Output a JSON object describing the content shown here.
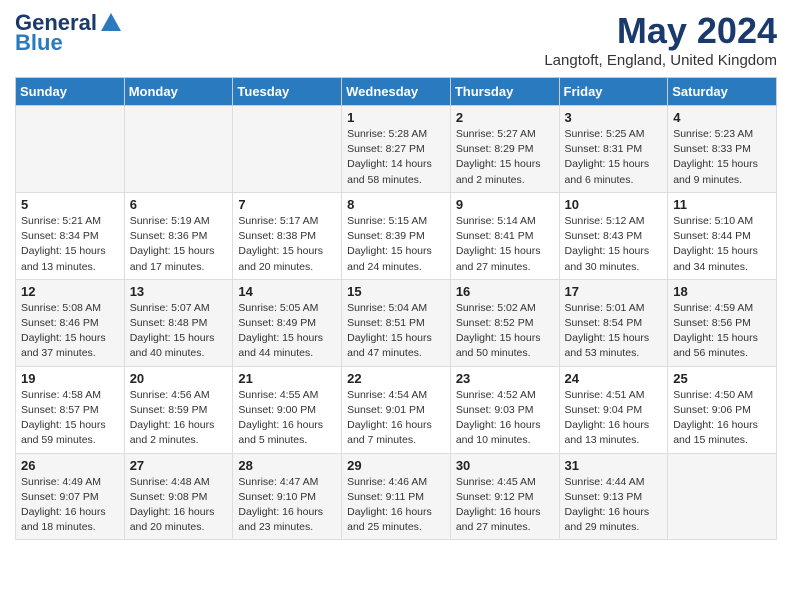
{
  "header": {
    "logo_general": "General",
    "logo_blue": "Blue",
    "month_title": "May 2024",
    "location": "Langtoft, England, United Kingdom"
  },
  "days_of_week": [
    "Sunday",
    "Monday",
    "Tuesday",
    "Wednesday",
    "Thursday",
    "Friday",
    "Saturday"
  ],
  "weeks": [
    [
      {
        "day": "",
        "sunrise": "",
        "sunset": "",
        "daylight": ""
      },
      {
        "day": "",
        "sunrise": "",
        "sunset": "",
        "daylight": ""
      },
      {
        "day": "",
        "sunrise": "",
        "sunset": "",
        "daylight": ""
      },
      {
        "day": "1",
        "sunrise": "Sunrise: 5:28 AM",
        "sunset": "Sunset: 8:27 PM",
        "daylight": "Daylight: 14 hours and 58 minutes."
      },
      {
        "day": "2",
        "sunrise": "Sunrise: 5:27 AM",
        "sunset": "Sunset: 8:29 PM",
        "daylight": "Daylight: 15 hours and 2 minutes."
      },
      {
        "day": "3",
        "sunrise": "Sunrise: 5:25 AM",
        "sunset": "Sunset: 8:31 PM",
        "daylight": "Daylight: 15 hours and 6 minutes."
      },
      {
        "day": "4",
        "sunrise": "Sunrise: 5:23 AM",
        "sunset": "Sunset: 8:33 PM",
        "daylight": "Daylight: 15 hours and 9 minutes."
      }
    ],
    [
      {
        "day": "5",
        "sunrise": "Sunrise: 5:21 AM",
        "sunset": "Sunset: 8:34 PM",
        "daylight": "Daylight: 15 hours and 13 minutes."
      },
      {
        "day": "6",
        "sunrise": "Sunrise: 5:19 AM",
        "sunset": "Sunset: 8:36 PM",
        "daylight": "Daylight: 15 hours and 17 minutes."
      },
      {
        "day": "7",
        "sunrise": "Sunrise: 5:17 AM",
        "sunset": "Sunset: 8:38 PM",
        "daylight": "Daylight: 15 hours and 20 minutes."
      },
      {
        "day": "8",
        "sunrise": "Sunrise: 5:15 AM",
        "sunset": "Sunset: 8:39 PM",
        "daylight": "Daylight: 15 hours and 24 minutes."
      },
      {
        "day": "9",
        "sunrise": "Sunrise: 5:14 AM",
        "sunset": "Sunset: 8:41 PM",
        "daylight": "Daylight: 15 hours and 27 minutes."
      },
      {
        "day": "10",
        "sunrise": "Sunrise: 5:12 AM",
        "sunset": "Sunset: 8:43 PM",
        "daylight": "Daylight: 15 hours and 30 minutes."
      },
      {
        "day": "11",
        "sunrise": "Sunrise: 5:10 AM",
        "sunset": "Sunset: 8:44 PM",
        "daylight": "Daylight: 15 hours and 34 minutes."
      }
    ],
    [
      {
        "day": "12",
        "sunrise": "Sunrise: 5:08 AM",
        "sunset": "Sunset: 8:46 PM",
        "daylight": "Daylight: 15 hours and 37 minutes."
      },
      {
        "day": "13",
        "sunrise": "Sunrise: 5:07 AM",
        "sunset": "Sunset: 8:48 PM",
        "daylight": "Daylight: 15 hours and 40 minutes."
      },
      {
        "day": "14",
        "sunrise": "Sunrise: 5:05 AM",
        "sunset": "Sunset: 8:49 PM",
        "daylight": "Daylight: 15 hours and 44 minutes."
      },
      {
        "day": "15",
        "sunrise": "Sunrise: 5:04 AM",
        "sunset": "Sunset: 8:51 PM",
        "daylight": "Daylight: 15 hours and 47 minutes."
      },
      {
        "day": "16",
        "sunrise": "Sunrise: 5:02 AM",
        "sunset": "Sunset: 8:52 PM",
        "daylight": "Daylight: 15 hours and 50 minutes."
      },
      {
        "day": "17",
        "sunrise": "Sunrise: 5:01 AM",
        "sunset": "Sunset: 8:54 PM",
        "daylight": "Daylight: 15 hours and 53 minutes."
      },
      {
        "day": "18",
        "sunrise": "Sunrise: 4:59 AM",
        "sunset": "Sunset: 8:56 PM",
        "daylight": "Daylight: 15 hours and 56 minutes."
      }
    ],
    [
      {
        "day": "19",
        "sunrise": "Sunrise: 4:58 AM",
        "sunset": "Sunset: 8:57 PM",
        "daylight": "Daylight: 15 hours and 59 minutes."
      },
      {
        "day": "20",
        "sunrise": "Sunrise: 4:56 AM",
        "sunset": "Sunset: 8:59 PM",
        "daylight": "Daylight: 16 hours and 2 minutes."
      },
      {
        "day": "21",
        "sunrise": "Sunrise: 4:55 AM",
        "sunset": "Sunset: 9:00 PM",
        "daylight": "Daylight: 16 hours and 5 minutes."
      },
      {
        "day": "22",
        "sunrise": "Sunrise: 4:54 AM",
        "sunset": "Sunset: 9:01 PM",
        "daylight": "Daylight: 16 hours and 7 minutes."
      },
      {
        "day": "23",
        "sunrise": "Sunrise: 4:52 AM",
        "sunset": "Sunset: 9:03 PM",
        "daylight": "Daylight: 16 hours and 10 minutes."
      },
      {
        "day": "24",
        "sunrise": "Sunrise: 4:51 AM",
        "sunset": "Sunset: 9:04 PM",
        "daylight": "Daylight: 16 hours and 13 minutes."
      },
      {
        "day": "25",
        "sunrise": "Sunrise: 4:50 AM",
        "sunset": "Sunset: 9:06 PM",
        "daylight": "Daylight: 16 hours and 15 minutes."
      }
    ],
    [
      {
        "day": "26",
        "sunrise": "Sunrise: 4:49 AM",
        "sunset": "Sunset: 9:07 PM",
        "daylight": "Daylight: 16 hours and 18 minutes."
      },
      {
        "day": "27",
        "sunrise": "Sunrise: 4:48 AM",
        "sunset": "Sunset: 9:08 PM",
        "daylight": "Daylight: 16 hours and 20 minutes."
      },
      {
        "day": "28",
        "sunrise": "Sunrise: 4:47 AM",
        "sunset": "Sunset: 9:10 PM",
        "daylight": "Daylight: 16 hours and 23 minutes."
      },
      {
        "day": "29",
        "sunrise": "Sunrise: 4:46 AM",
        "sunset": "Sunset: 9:11 PM",
        "daylight": "Daylight: 16 hours and 25 minutes."
      },
      {
        "day": "30",
        "sunrise": "Sunrise: 4:45 AM",
        "sunset": "Sunset: 9:12 PM",
        "daylight": "Daylight: 16 hours and 27 minutes."
      },
      {
        "day": "31",
        "sunrise": "Sunrise: 4:44 AM",
        "sunset": "Sunset: 9:13 PM",
        "daylight": "Daylight: 16 hours and 29 minutes."
      },
      {
        "day": "",
        "sunrise": "",
        "sunset": "",
        "daylight": ""
      }
    ]
  ]
}
